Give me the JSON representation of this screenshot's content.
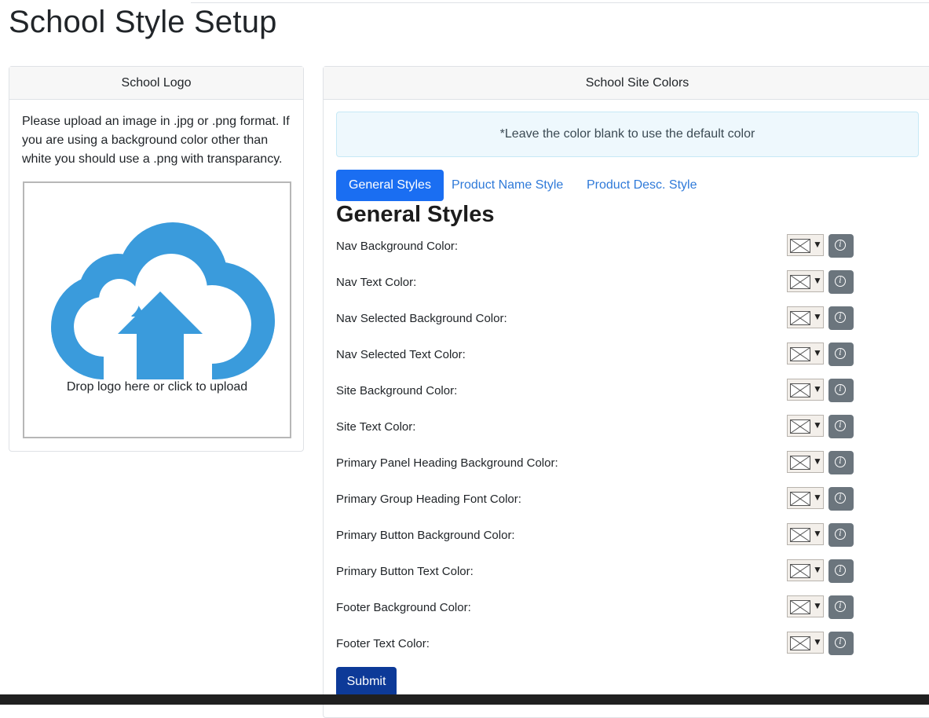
{
  "page": {
    "title": "School Style Setup"
  },
  "logo_card": {
    "header": "School Logo",
    "instructions": "Please upload an image in .jpg or .png format. If you are using a background color other than white you should use a .png with transparancy.",
    "dropzone_label": "Drop logo here or click to upload",
    "icon": "cloud-upload-icon",
    "icon_color": "#3a9bdc"
  },
  "colors_card": {
    "header": "School Site Colors",
    "alert": "*Leave the color blank to use the default color",
    "tabs": [
      {
        "label": "General Styles",
        "active": true
      },
      {
        "label": "Product Name Style",
        "active": false
      },
      {
        "label": "Product Desc. Style",
        "active": false
      }
    ],
    "section_title": "General Styles",
    "fields": [
      {
        "label": "Nav Background Color:"
      },
      {
        "label": "Nav Text Color:"
      },
      {
        "label": "Nav Selected Background Color:"
      },
      {
        "label": "Nav Selected Text Color:"
      },
      {
        "label": "Site Background Color:"
      },
      {
        "label": "Site Text Color:"
      },
      {
        "label": "Primary Panel Heading Background Color:"
      },
      {
        "label": "Primary Group Heading Font Color:"
      },
      {
        "label": "Primary Button Background Color:"
      },
      {
        "label": "Primary Button Text Color:"
      },
      {
        "label": "Footer Background Color:"
      },
      {
        "label": "Footer Text Color:"
      }
    ],
    "submit_label": "Submit"
  },
  "colors": {
    "active_tab": "#1a6ef2",
    "link": "#2f7ad9",
    "submit": "#0d3a98",
    "info_button": "#6b757d"
  }
}
